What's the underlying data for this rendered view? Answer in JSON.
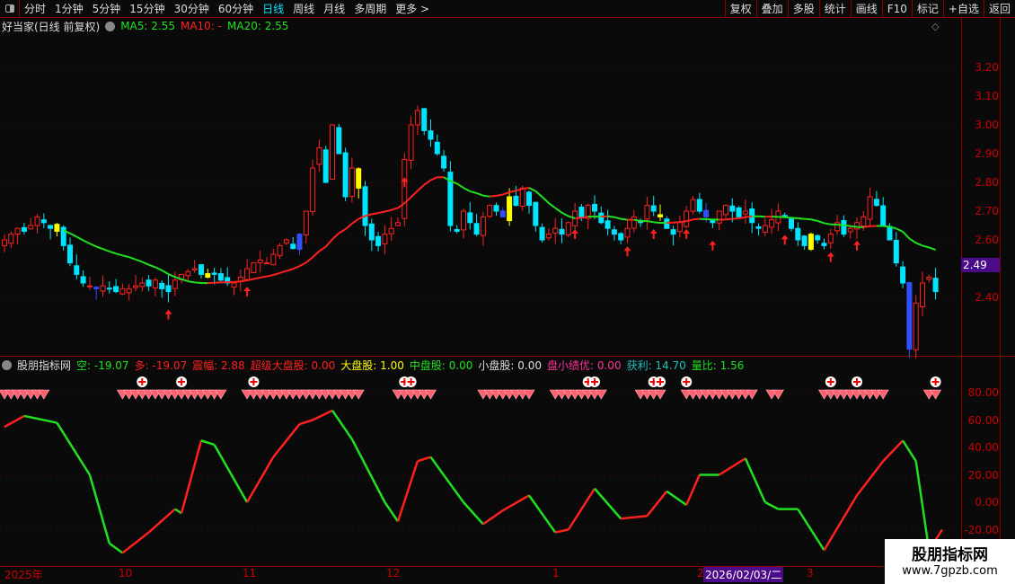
{
  "toolbar": {
    "periods": [
      "分时",
      "1分钟",
      "5分钟",
      "15分钟",
      "30分钟",
      "60分钟",
      "日线",
      "周线",
      "月线",
      "多周期",
      "更多 >"
    ],
    "active": "日线",
    "right_buttons": [
      "复权",
      "叠加",
      "多股",
      "统计",
      "画线",
      "F10",
      "标记",
      "+自选",
      "返回"
    ]
  },
  "main": {
    "title": "好当家(日线 前复权)",
    "ma5": "MA5: 2.55",
    "ma10": "MA10: -",
    "ma20": "MA20: 2.55",
    "y_labels": [
      "3.20",
      "3.10",
      "3.00",
      "2.90",
      "2.80",
      "2.70",
      "2.60",
      "2.40"
    ],
    "last_price": "2.49"
  },
  "indicator": {
    "name": "股朋指标网",
    "kong": "空: -19.07",
    "duo": "多: -19.07",
    "zhenfu": "震幅: 2.88",
    "chaoji": "超级大盘股: 0.00",
    "dapan": "大盘股: 1.00",
    "zhongpan": "中盘股: 0.00",
    "xiaopan": "小盘股: 0.00",
    "panxiao": "盘小绩优: 0.00",
    "huoli": "获利: 14.70",
    "liangbi": "量比: 1.56",
    "y_labels": [
      "80.00",
      "60.00",
      "40.00",
      "20.00",
      "0.00",
      "-20.00"
    ]
  },
  "dates": {
    "labels": [
      "2025年",
      "10",
      "11",
      "12",
      "1",
      "2",
      "3"
    ],
    "cursor": "2026/02/03/二"
  },
  "watermark": {
    "name": "股朋指标网",
    "url": "www.7gpzb.com"
  },
  "colors": {
    "up": "#ff2020",
    "down": "#00e5ff",
    "ma": "#20e020",
    "accent": "#8b0000"
  },
  "chart_data": {
    "type": "candlestick",
    "closes": [
      2.6,
      2.62,
      2.64,
      2.63,
      2.65,
      2.68,
      2.66,
      2.64,
      2.63,
      2.58,
      2.52,
      2.48,
      2.45,
      2.44,
      2.43,
      2.44,
      2.43,
      2.42,
      2.43,
      2.43,
      2.44,
      2.45,
      2.44,
      2.46,
      2.43,
      2.42,
      2.46,
      2.48,
      2.49,
      2.5,
      2.48,
      2.47,
      2.48,
      2.46,
      2.45,
      2.45,
      2.47,
      2.5,
      2.52,
      2.53,
      2.52,
      2.55,
      2.58,
      2.6,
      2.57,
      2.62,
      2.7,
      2.85,
      2.92,
      2.8,
      3.0,
      2.9,
      2.75,
      2.85,
      2.78,
      2.65,
      2.6,
      2.58,
      2.62,
      2.64,
      2.66,
      2.88,
      3.0,
      3.05,
      2.98,
      2.95,
      2.9,
      2.85,
      2.65,
      2.63,
      2.7,
      2.66,
      2.62,
      2.68,
      2.72,
      2.7,
      2.68,
      2.75,
      2.72,
      2.78,
      2.72,
      2.65,
      2.6,
      2.62,
      2.64,
      2.62,
      2.66,
      2.7,
      2.68,
      2.72,
      2.7,
      2.66,
      2.64,
      2.62,
      2.6,
      2.64,
      2.68,
      2.66,
      2.72,
      2.7,
      2.68,
      2.64,
      2.62,
      2.66,
      2.7,
      2.74,
      2.7,
      2.68,
      2.66,
      2.7,
      2.72,
      2.7,
      2.68,
      2.7,
      2.66,
      2.64,
      2.65,
      2.67,
      2.7,
      2.68,
      2.64,
      2.6,
      2.58,
      2.62,
      2.6,
      2.58,
      2.62,
      2.66,
      2.62,
      2.64,
      2.66,
      2.68,
      2.75,
      2.72,
      2.65,
      2.6,
      2.52,
      2.45,
      2.22,
      2.38,
      2.45,
      2.47,
      2.42
    ],
    "indicator_points": [
      [
        0,
        55
      ],
      [
        3,
        63
      ],
      [
        8,
        58
      ],
      [
        13,
        20
      ],
      [
        16,
        -30
      ],
      [
        18,
        -37
      ],
      [
        22,
        -22
      ],
      [
        26,
        -5
      ],
      [
        27,
        -8
      ],
      [
        30,
        45
      ],
      [
        32,
        42
      ],
      [
        37,
        0
      ],
      [
        41,
        33
      ],
      [
        45,
        57
      ],
      [
        47,
        60
      ],
      [
        50,
        67
      ],
      [
        53,
        46
      ],
      [
        58,
        0
      ],
      [
        60,
        -14
      ],
      [
        63,
        30
      ],
      [
        65,
        33
      ],
      [
        70,
        0
      ],
      [
        73,
        -16
      ],
      [
        76,
        -6
      ],
      [
        80,
        5
      ],
      [
        84,
        -22
      ],
      [
        86,
        -20
      ],
      [
        90,
        10
      ],
      [
        94,
        -12
      ],
      [
        98,
        -10
      ],
      [
        101,
        8
      ],
      [
        104,
        -2
      ],
      [
        106,
        20
      ],
      [
        109,
        20
      ],
      [
        113,
        32
      ],
      [
        116,
        0
      ],
      [
        118,
        -5
      ],
      [
        121,
        -5
      ],
      [
        125,
        -35
      ],
      [
        130,
        5
      ],
      [
        134,
        30
      ],
      [
        137,
        45
      ],
      [
        139,
        30
      ],
      [
        141,
        -35
      ],
      [
        143,
        -20
      ]
    ],
    "diamond_ranges": [
      [
        0,
        6
      ],
      [
        18,
        33
      ],
      [
        37,
        54
      ],
      [
        60,
        65
      ],
      [
        73,
        80
      ],
      [
        84,
        91
      ],
      [
        97,
        100
      ],
      [
        104,
        106
      ],
      [
        107,
        114
      ],
      [
        117,
        118
      ],
      [
        125,
        134
      ],
      [
        141,
        142
      ]
    ],
    "plus_marks": [
      21,
      27,
      38,
      61,
      62,
      89,
      90,
      99,
      100,
      104,
      126,
      130,
      142
    ],
    "buy_arrows": [
      25,
      37,
      61,
      87,
      95,
      99,
      104,
      108,
      119,
      126,
      130
    ],
    "price_range": [
      2.2,
      3.3
    ],
    "indicator_range": [
      -30,
      90
    ]
  }
}
